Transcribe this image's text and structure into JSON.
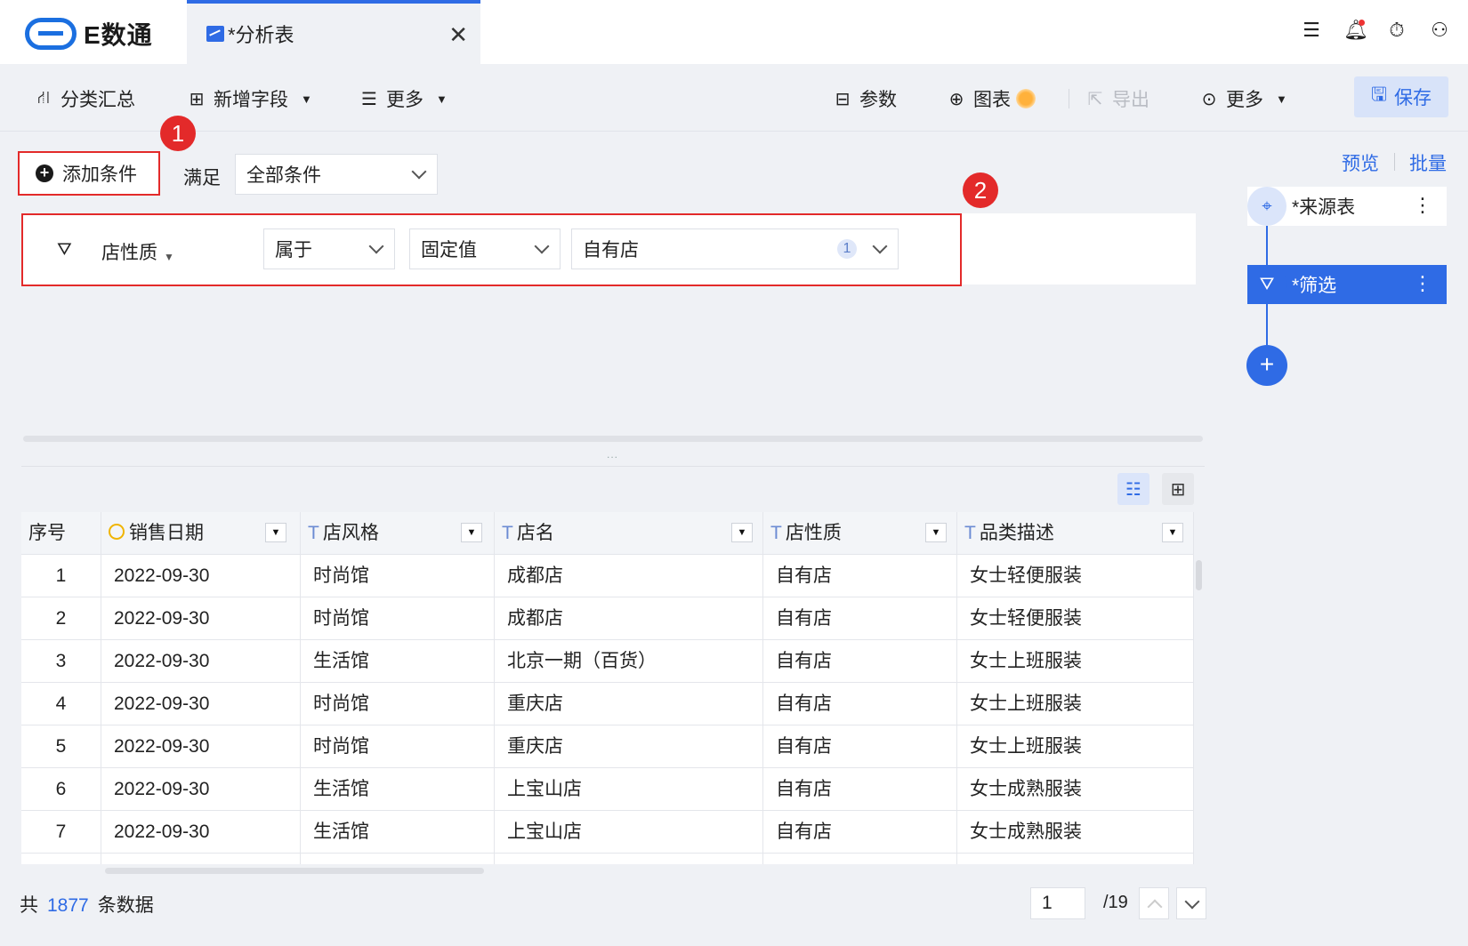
{
  "app": {
    "logo_text": "E数通"
  },
  "tab": {
    "title": "*分析表",
    "close": "✕"
  },
  "topbar_icons": [
    "list-icon",
    "bell-icon",
    "timer-icon",
    "user-icon"
  ],
  "toolbar": {
    "group_summary": "分类汇总",
    "add_field": "新增字段",
    "more_left": "更多",
    "params": "参数",
    "chart": "图表",
    "export": "导出",
    "more_right": "更多",
    "save": "保存"
  },
  "annotations": {
    "badge1": "1",
    "badge2": "2"
  },
  "filter": {
    "add_condition": "添加条件",
    "satisfy_label": "满足",
    "match_mode": "全部条件",
    "field": "店性质",
    "operator": "属于",
    "value_type": "固定值",
    "value": "自有店",
    "value_count": "1"
  },
  "splitter_dots": "...",
  "table": {
    "columns": [
      {
        "label": "序号",
        "type": ""
      },
      {
        "label": "销售日期",
        "type": "date"
      },
      {
        "label": "店风格",
        "type": "T"
      },
      {
        "label": "店名",
        "type": "T"
      },
      {
        "label": "店性质",
        "type": "T"
      },
      {
        "label": "品类描述",
        "type": "T"
      }
    ],
    "rows": [
      [
        "1",
        "2022-09-30",
        "时尚馆",
        "成都店",
        "自有店",
        "女士轻便服装"
      ],
      [
        "2",
        "2022-09-30",
        "时尚馆",
        "成都店",
        "自有店",
        "女士轻便服装"
      ],
      [
        "3",
        "2022-09-30",
        "生活馆",
        "北京一期（百货）",
        "自有店",
        "女士上班服装"
      ],
      [
        "4",
        "2022-09-30",
        "时尚馆",
        "重庆店",
        "自有店",
        "女士上班服装"
      ],
      [
        "5",
        "2022-09-30",
        "时尚馆",
        "重庆店",
        "自有店",
        "女士上班服装"
      ],
      [
        "6",
        "2022-09-30",
        "生活馆",
        "上宝山店",
        "自有店",
        "女士成熟服装"
      ],
      [
        "7",
        "2022-09-30",
        "生活馆",
        "上宝山店",
        "自有店",
        "女士成熟服装"
      ]
    ]
  },
  "footer": {
    "total_prefix": "共",
    "total_count": "1877",
    "total_suffix": "条数据",
    "page_current": "1",
    "page_total": "/19"
  },
  "flow": {
    "preview": "预览",
    "batch": "批量",
    "nodes": [
      {
        "label": "*来源表",
        "icon": "crosshair-icon"
      },
      {
        "label": "*筛选",
        "icon": "filter-icon"
      }
    ],
    "add": "+"
  },
  "colors": {
    "accent": "#2f6be5",
    "annotation_red": "#e32a2a",
    "date_icon": "#f0b400"
  }
}
